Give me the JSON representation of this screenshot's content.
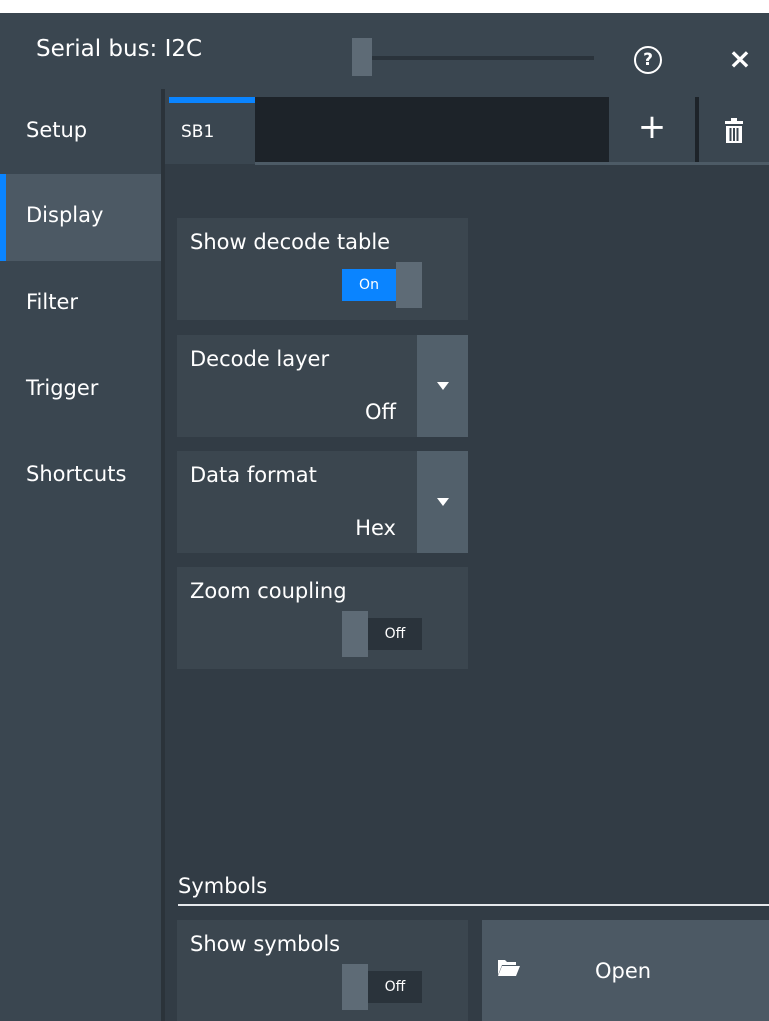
{
  "window": {
    "title": "Serial bus: I2C",
    "help_icon": "?",
    "close_icon": "×"
  },
  "sidebar": {
    "items": [
      {
        "label": "Setup",
        "active": false
      },
      {
        "label": "Display",
        "active": true
      },
      {
        "label": "Filter",
        "active": false
      },
      {
        "label": "Trigger",
        "active": false
      },
      {
        "label": "Shortcuts",
        "active": false
      }
    ]
  },
  "tabs": {
    "active_label": "SB1",
    "add_label": "+",
    "icons": {
      "add": "plus-icon",
      "delete": "trash-icon"
    }
  },
  "settings": {
    "show_decode_table": {
      "label": "Show decode table",
      "state": "On"
    },
    "decode_layer": {
      "label": "Decode layer",
      "value": "Off"
    },
    "data_format": {
      "label": "Data format",
      "value": "Hex"
    },
    "zoom_coupling": {
      "label": "Zoom coupling",
      "state": "Off"
    }
  },
  "symbols": {
    "section_title": "Symbols",
    "show_symbols": {
      "label": "Show symbols",
      "state": "Off"
    },
    "open_label": "Open",
    "open_icon": "folder-open-icon"
  },
  "colors": {
    "accent": "#0a84ff",
    "panel": "#3a4650",
    "background": "#323c45"
  }
}
